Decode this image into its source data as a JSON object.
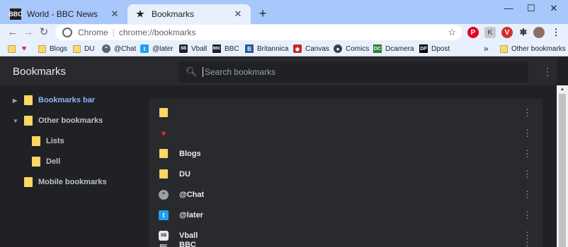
{
  "browser": {
    "tabs": [
      {
        "title": "World - BBC News",
        "favicon": "BBC",
        "active": false
      },
      {
        "title": "Bookmarks",
        "favicon": "star-icon",
        "active": true
      }
    ],
    "omnibox": {
      "scheme": "Chrome",
      "url": "chrome://bookmarks"
    },
    "bookmarks_bar": [
      {
        "label": "",
        "icon": "folder-icon"
      },
      {
        "label": "",
        "icon": "heart-icon"
      },
      {
        "label": "Blogs",
        "icon": "folder-icon"
      },
      {
        "label": "DU",
        "icon": "folder-icon"
      },
      {
        "label": "@Chat",
        "icon": "chat-icon"
      },
      {
        "label": "@later",
        "icon": "twitter-icon"
      },
      {
        "label": "Vball",
        "icon": "vball-icon"
      },
      {
        "label": "BBC",
        "icon": "bbc-icon"
      },
      {
        "label": "Britannica",
        "icon": "britannica-icon"
      },
      {
        "label": "Canvas",
        "icon": "canvas-icon"
      },
      {
        "label": "Comics",
        "icon": "comics-icon"
      },
      {
        "label": "Dcamera",
        "icon": "dcamera-icon"
      },
      {
        "label": "Dpost",
        "icon": "dpost-icon"
      }
    ],
    "overflow_chevron": "»",
    "other_bookmarks": "Other bookmarks"
  },
  "page": {
    "title": "Bookmarks",
    "search_placeholder": "Search bookmarks",
    "tree": [
      {
        "label": "Bookmarks bar",
        "expanded": false,
        "selected": true,
        "depth": 0
      },
      {
        "label": "Other bookmarks",
        "expanded": true,
        "selected": false,
        "depth": 0
      },
      {
        "label": "Lists",
        "depth": 1
      },
      {
        "label": "Dell",
        "depth": 1
      },
      {
        "label": "Mobile bookmarks",
        "depth": 0
      }
    ],
    "rows": [
      {
        "label": "",
        "icon": "folder-icon"
      },
      {
        "label": "",
        "icon": "heart-icon"
      },
      {
        "label": "Blogs",
        "icon": "folder-icon"
      },
      {
        "label": "DU",
        "icon": "folder-icon"
      },
      {
        "label": "@Chat",
        "icon": "chat-icon"
      },
      {
        "label": "@later",
        "icon": "twitter-icon"
      },
      {
        "label": "Vball",
        "icon": "vball-icon"
      },
      {
        "label": "BBC",
        "icon": "bbc-icon"
      }
    ]
  },
  "colors": {
    "accent": "#8ab4f8",
    "folder": "#fdd663",
    "tabstrip": "#a8c7fa",
    "page_bg": "#202124"
  }
}
